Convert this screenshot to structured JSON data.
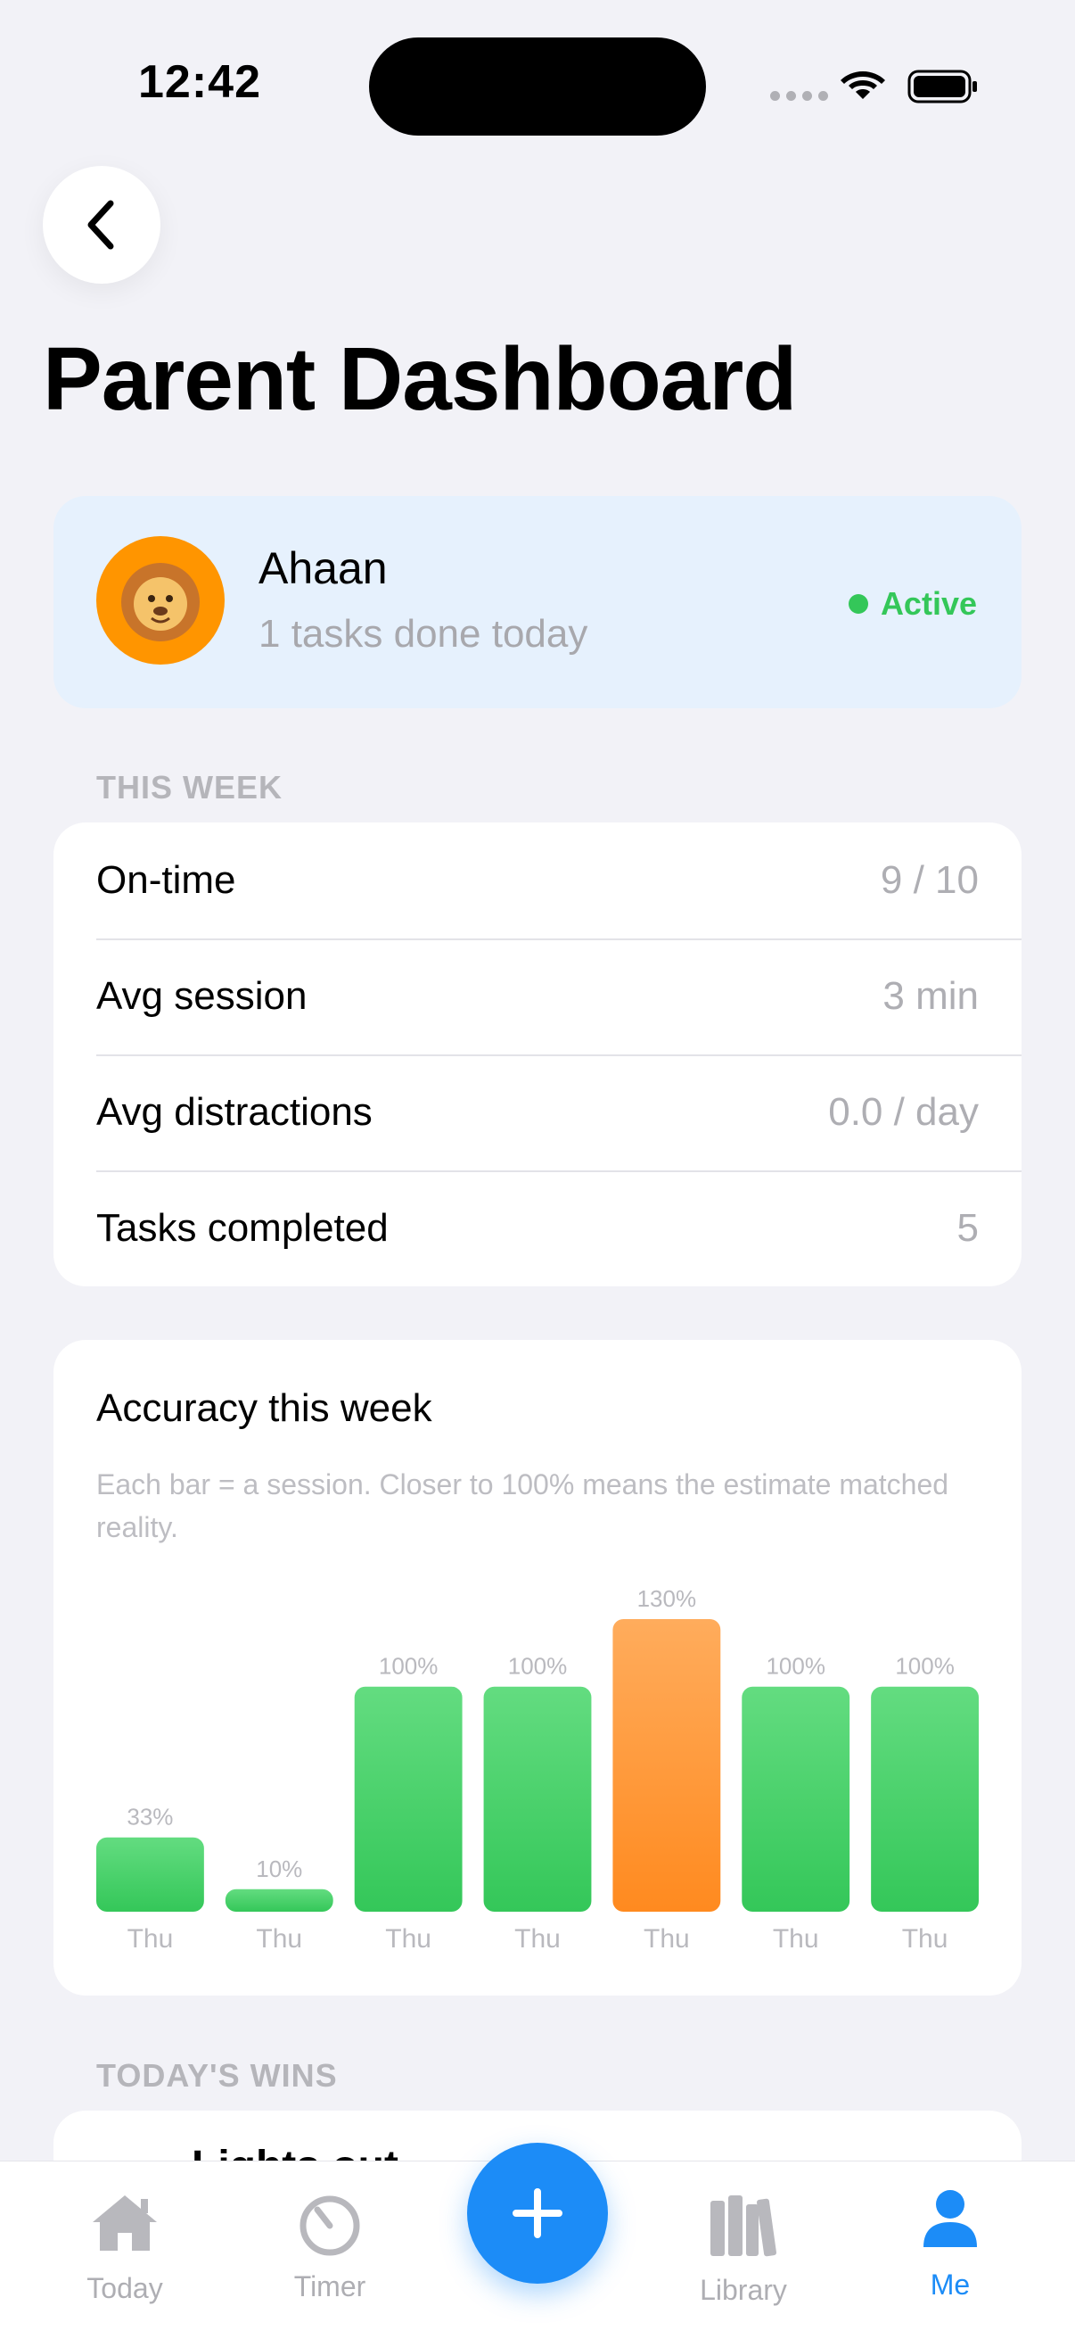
{
  "status_bar": {
    "time": "12:42"
  },
  "header": {
    "title": "Parent Dashboard"
  },
  "profile": {
    "name": "Ahaan",
    "subtitle": "1 tasks done today",
    "status": "Active",
    "avatar_emoji": "🦁",
    "avatar_color": "#ff9500"
  },
  "this_week": {
    "header": "THIS WEEK",
    "rows": [
      {
        "label": "On-time",
        "value": "9 / 10"
      },
      {
        "label": "Avg session",
        "value": "3 min"
      },
      {
        "label": "Avg distractions",
        "value": "0.0 / day"
      },
      {
        "label": "Tasks completed",
        "value": "5"
      }
    ]
  },
  "accuracy": {
    "title": "Accuracy this week",
    "caption": "Each bar = a session. Closer to 100% means the estimate matched reality."
  },
  "chart_data": {
    "type": "bar",
    "categories": [
      "Thu",
      "Thu",
      "Thu",
      "Thu",
      "Thu",
      "Thu",
      "Thu"
    ],
    "values": [
      33,
      10,
      100,
      100,
      130,
      100,
      100
    ],
    "value_labels": [
      "33%",
      "10%",
      "100%",
      "100%",
      "130%",
      "100%",
      "100%"
    ],
    "colors": [
      "#34c759",
      "#34c759",
      "#34c759",
      "#34c759",
      "#ff9500",
      "#34c759",
      "#34c759"
    ],
    "title": "Accuracy this week",
    "xlabel": "",
    "ylabel": "",
    "ylim": [
      0,
      130
    ],
    "grid": false
  },
  "todays_wins": {
    "header": "TODAY'S WINS",
    "first_item": "Lights out"
  },
  "tab_bar": {
    "items": [
      {
        "label": "Today",
        "icon": "house-icon"
      },
      {
        "label": "Timer",
        "icon": "timer-icon"
      },
      {
        "label": "Library",
        "icon": "library-icon"
      },
      {
        "label": "Me",
        "icon": "person-icon"
      }
    ],
    "active": "Me",
    "accent": "#1c8cf7",
    "add_icon": "plus-icon"
  }
}
